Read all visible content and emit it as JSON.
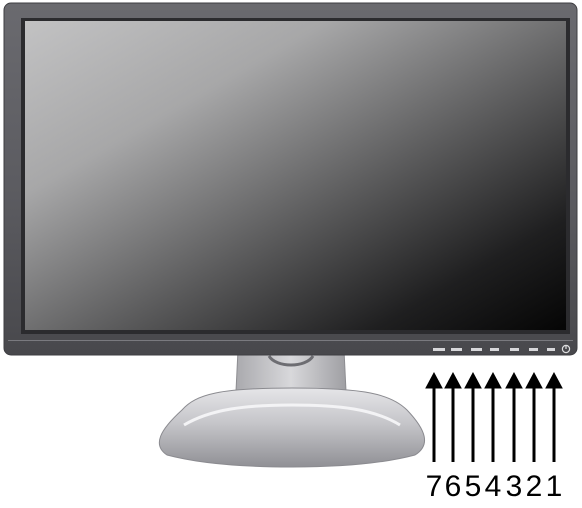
{
  "callouts": [
    {
      "number": "7",
      "target": "button-7"
    },
    {
      "number": "6",
      "target": "button-6"
    },
    {
      "number": "5",
      "target": "button-5"
    },
    {
      "number": "4",
      "target": "button-4"
    },
    {
      "number": "3",
      "target": "button-3"
    },
    {
      "number": "2",
      "target": "button-2"
    },
    {
      "number": "1",
      "target": "button-1"
    }
  ],
  "colors": {
    "bezel": "#5a5a5e",
    "screen_light": "#b9b9ba",
    "screen_dark": "#050505",
    "stand": "#c7c7ca",
    "arrow": "#000000"
  },
  "icons": [
    "power-icon"
  ]
}
